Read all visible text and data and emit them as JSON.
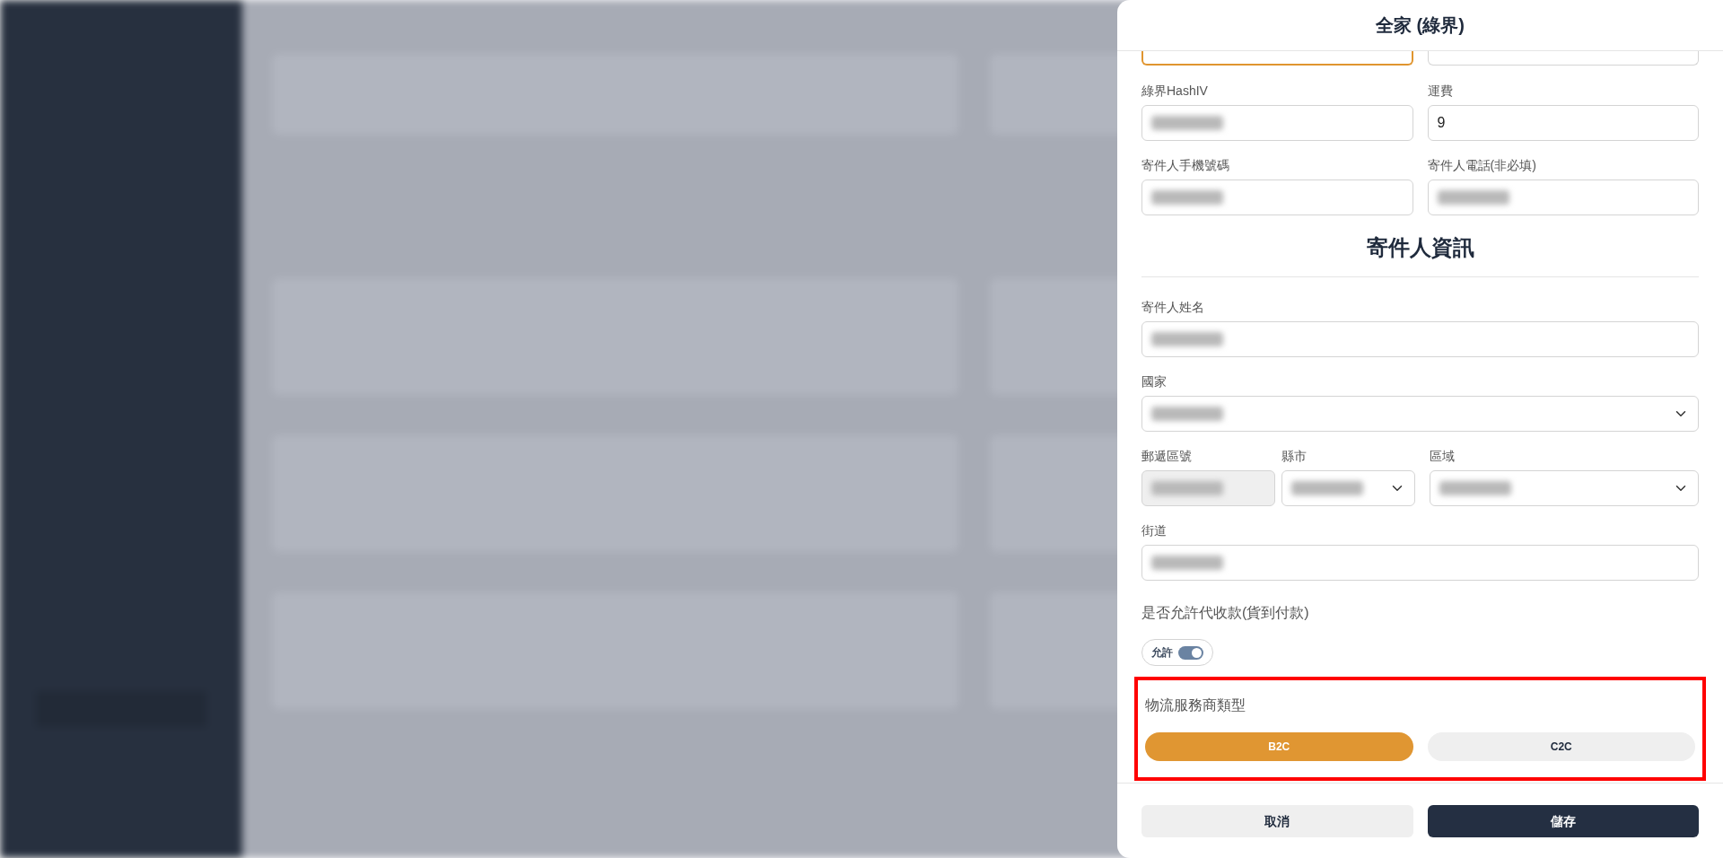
{
  "dialog": {
    "title": "全家 (綠界)",
    "partial_row": [
      {
        "focused": true
      },
      {
        "focused": false
      }
    ],
    "rows": [
      [
        {
          "label": "綠界HashIV",
          "kind": "input",
          "blurred": true
        },
        {
          "label": "運費",
          "kind": "input",
          "value": "9"
        }
      ],
      [
        {
          "label": "寄件人手機號碼",
          "kind": "input",
          "blurred": true
        },
        {
          "label": "寄件人電話(非必填)",
          "kind": "input",
          "blurred": true
        }
      ]
    ],
    "sender": {
      "heading": "寄件人資訊",
      "rows": [
        [
          {
            "label": "寄件人姓名",
            "kind": "input",
            "blurred": true
          }
        ],
        [
          {
            "label": "國家",
            "kind": "select",
            "blurred": true
          }
        ],
        [
          {
            "label": "郵遞區號",
            "kind": "input",
            "blurred": true,
            "disabled": true
          },
          {
            "label": "縣市",
            "kind": "select",
            "blurred": true
          },
          {
            "label": "區域",
            "kind": "select",
            "blurred": true
          }
        ],
        [
          {
            "label": "街道",
            "kind": "input",
            "blurred": true
          }
        ]
      ]
    },
    "cod": {
      "label": "是否允許代收款(貨到付款)",
      "toggle": {
        "label": "允許",
        "on": true
      }
    },
    "provider_type": {
      "label": "物流服務商類型",
      "highlighted": true,
      "options": [
        {
          "label": "B2C",
          "selected": true
        },
        {
          "label": "C2C",
          "selected": false
        }
      ]
    },
    "footer": {
      "buttons": [
        {
          "label": "取消",
          "kind": "secondary"
        },
        {
          "label": "儲存",
          "kind": "primary"
        }
      ]
    }
  }
}
